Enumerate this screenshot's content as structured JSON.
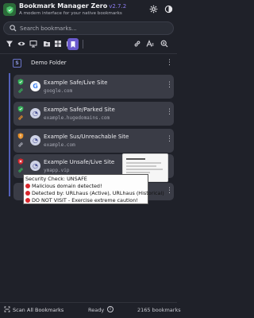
{
  "app": {
    "title": "Bookmark Manager Zero",
    "version": "v2.7.2",
    "subtitle": "A modern interface for your native bookmarks"
  },
  "search": {
    "placeholder": "Search bookmarks..."
  },
  "toolbar": {
    "icons": [
      "filter-icon",
      "eye-icon",
      "display-icon",
      "new-folder-icon",
      "grid-icon",
      "folder-icon",
      "bookmark-icon",
      "link-icon",
      "text-icon",
      "zoom-icon"
    ]
  },
  "folder": {
    "label": "Demo Folder",
    "icon_letter": "S"
  },
  "bookmarks": [
    {
      "name": "Example Safe/Live Site",
      "url": "google.com",
      "status_color": "#36b25a",
      "favicon": "G"
    },
    {
      "name": "Example Safe/Parked Site",
      "url": "example.hugedomains.com",
      "status_color": "#36b25a",
      "favicon": "◔"
    },
    {
      "name": "Example Sus/Unreachable Site",
      "url": "example.com",
      "status_color": "#e8912a",
      "favicon": "◔"
    },
    {
      "name": "Example Unsafe/Live Site",
      "url": "ymapp.vip",
      "status_color": "#d8262c",
      "favicon": "◔"
    }
  ],
  "tooltip": {
    "title": "Security Check: UNSAFE",
    "lines": [
      "Malicious domain detected!",
      "Detected by: URLhaus (Active), URLhaus (Historical)",
      "DO NOT VISIT - Exercise extreme caution!"
    ]
  },
  "footer": {
    "scan_label": "Scan All Bookmarks",
    "status": "Ready",
    "count": "2165 bookmarks"
  },
  "colors": {
    "accent": "#6a5acd",
    "background": "#1f2129",
    "card": "#3a3c46",
    "safe": "#36b25a",
    "suspicious": "#e8912a",
    "unsafe": "#d8262c"
  }
}
